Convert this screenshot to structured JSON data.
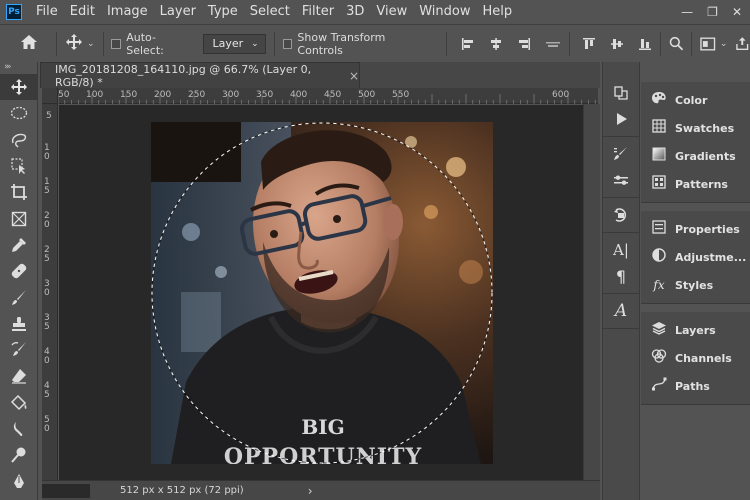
{
  "app": {
    "logo_text": "Ps"
  },
  "menu": [
    "File",
    "Edit",
    "Image",
    "Layer",
    "Type",
    "Select",
    "Filter",
    "3D",
    "View",
    "Window",
    "Help"
  ],
  "options": {
    "auto_select_label": "Auto-Select:",
    "layer_select_value": "Layer",
    "show_transform_label": "Show Transform Controls"
  },
  "document": {
    "tab_title": "IMG_20181208_164110.jpg @ 66.7% (Layer 0, RGB/8) *",
    "close_glyph": "×",
    "status_text": "512 px x 512 px (72 ppi)",
    "status_arrow": "›",
    "photo_text_line1": "BIG",
    "photo_text_line2": "OPPORTUNITY"
  },
  "ruler_h": [
    "50",
    "100",
    "150",
    "200",
    "250",
    "300",
    "350",
    "400",
    "450",
    "500",
    "550",
    "600"
  ],
  "ruler_v": [
    "5",
    "1 0",
    "1 5",
    "2 0",
    "2 5",
    "3 0",
    "3 5",
    "4 0",
    "4 5",
    "5 0"
  ],
  "panels": {
    "group1": [
      {
        "label": "Color",
        "icon": "color-palette-icon"
      },
      {
        "label": "Swatches",
        "icon": "swatches-grid-icon"
      },
      {
        "label": "Gradients",
        "icon": "gradient-icon"
      },
      {
        "label": "Patterns",
        "icon": "patterns-grid-icon"
      }
    ],
    "group2": [
      {
        "label": "Properties",
        "icon": "properties-icon"
      },
      {
        "label": "Adjustme...",
        "icon": "adjustments-icon"
      },
      {
        "label": "Styles",
        "icon": "fx-icon"
      }
    ],
    "group3": [
      {
        "label": "Layers",
        "icon": "layers-stack-icon"
      },
      {
        "label": "Channels",
        "icon": "channels-icon"
      },
      {
        "label": "Paths",
        "icon": "paths-icon"
      }
    ]
  },
  "colors": {
    "bg": "#535353",
    "canvas": "#282828",
    "panel_dark": "#4a4a4a",
    "ps_blue": "#31a8ff"
  }
}
